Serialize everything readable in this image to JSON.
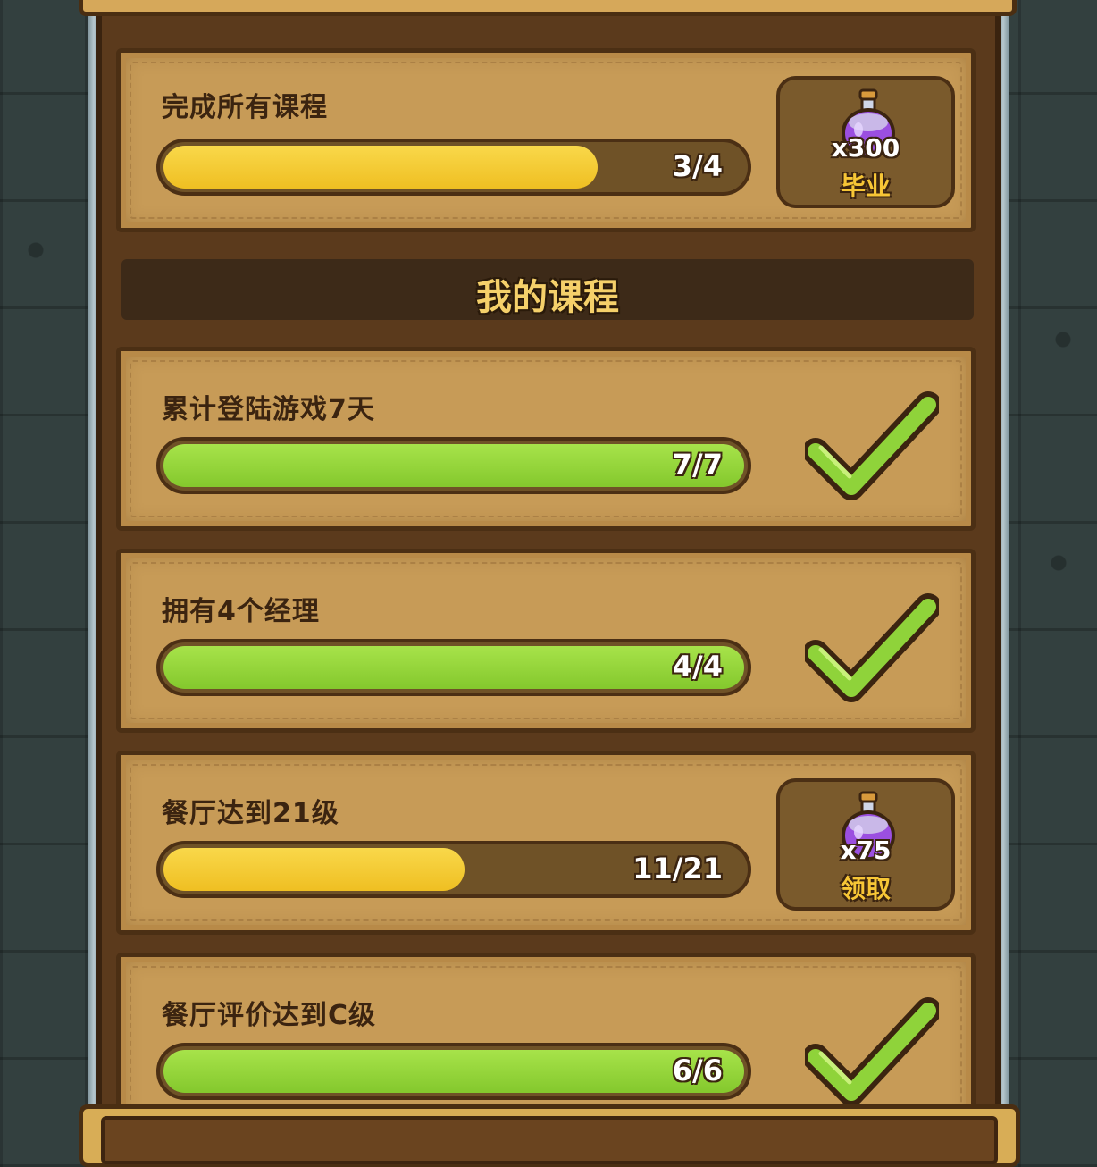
{
  "graduation": {
    "title": "完成所有课程",
    "progress_text": "3/4",
    "progress_fraction": 0.75,
    "reward_amount": "x300",
    "reward_label": "毕业",
    "reward_icon": "purple-potion-icon"
  },
  "section": {
    "title": "我的课程"
  },
  "courses": [
    {
      "title": "累计登陆游戏7天",
      "progress_text": "7/7",
      "progress_fraction": 1.0,
      "status": "completed"
    },
    {
      "title": "拥有4个经理",
      "progress_text": "4/4",
      "progress_fraction": 1.0,
      "status": "completed"
    },
    {
      "title": "餐厅达到21级",
      "progress_text": "11/21",
      "progress_fraction": 0.524,
      "status": "claimable",
      "reward_amount": "x75",
      "reward_label": "领取",
      "reward_icon": "purple-potion-icon"
    },
    {
      "title": "餐厅评价达到C级",
      "progress_text": "6/6",
      "progress_fraction": 1.0,
      "status": "completed"
    }
  ],
  "colors": {
    "yellow_fill": "#f2c52c",
    "green_fill": "#8fd33a",
    "wood": "#c79b57",
    "frame": "#5b3a1c"
  }
}
